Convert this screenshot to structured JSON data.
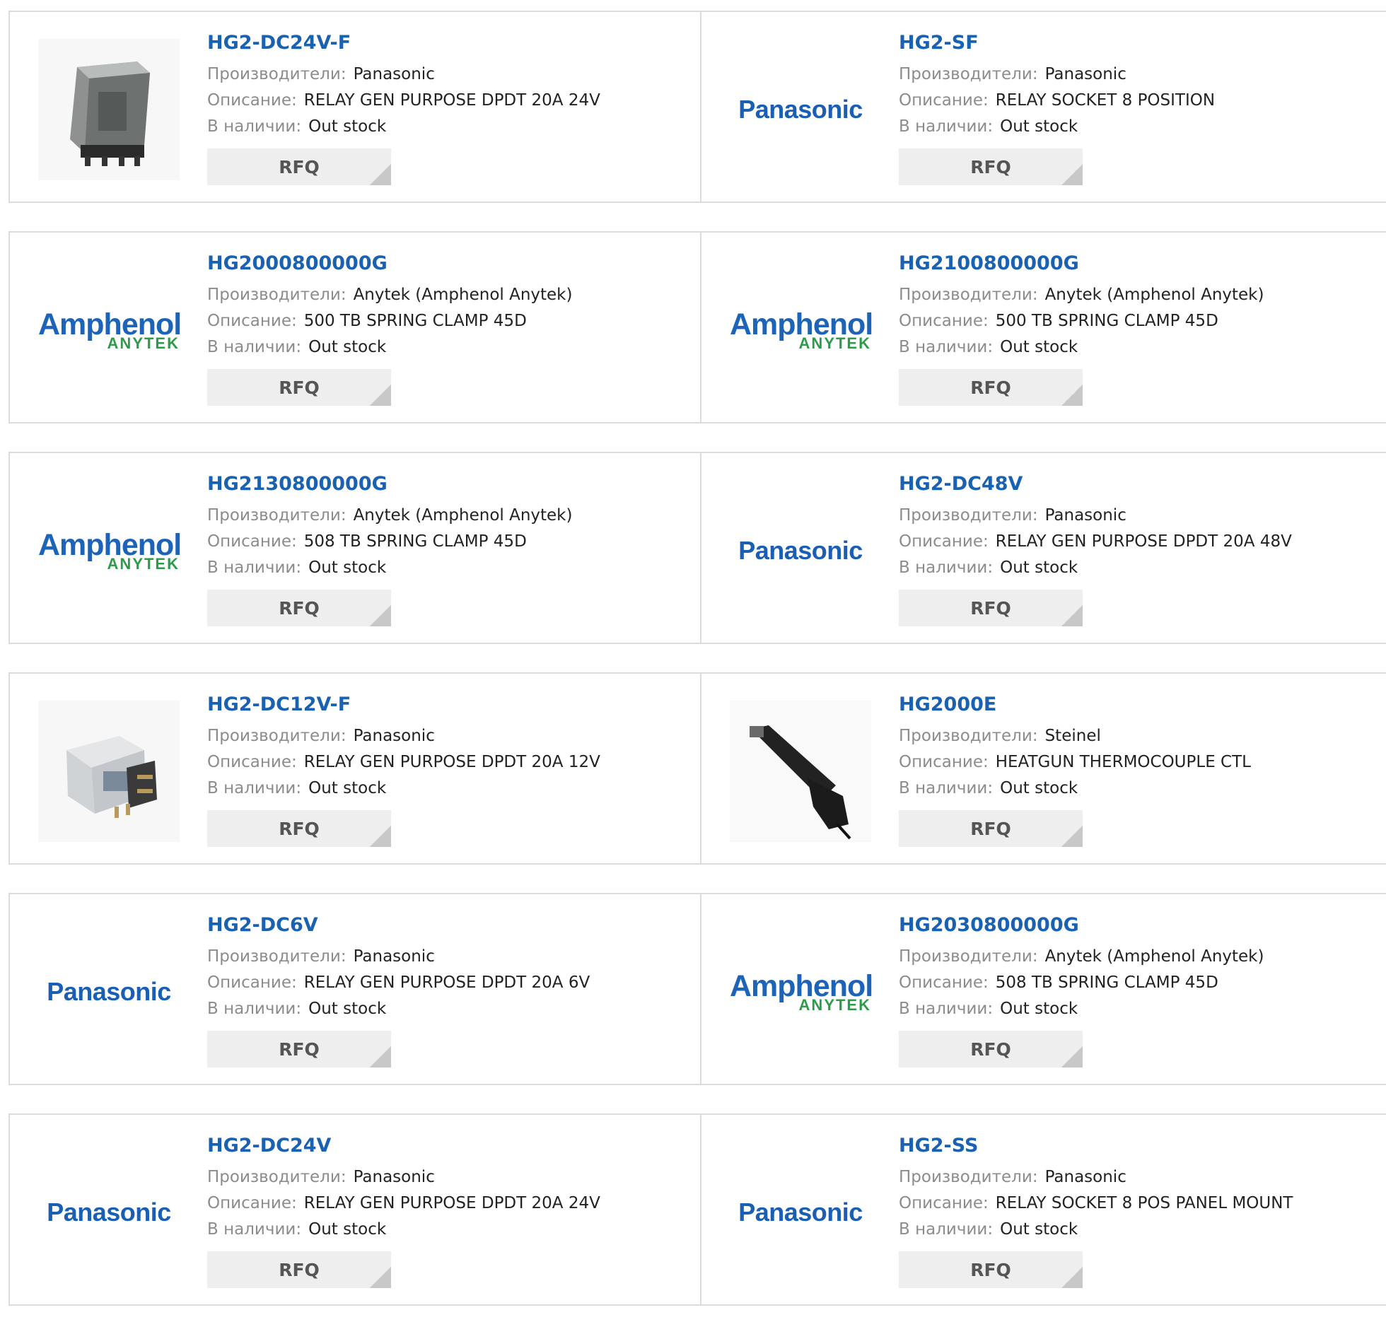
{
  "labels": {
    "manufacturer": "Производители:",
    "description": "Описание:",
    "stock": "В наличии:",
    "rfq": "RFQ"
  },
  "colors": {
    "link": "#1a62b0",
    "label": "#8c8c8c",
    "panasonic_logo": "#1a5fb4",
    "amphenol_logo": "#1d63b7",
    "anytek_logo": "#2d9c4a",
    "border": "#dcdcdc"
  },
  "logos": {
    "panasonic": "Panasonic",
    "amphenol": "Amphenol",
    "anytek": "ANYTEK"
  },
  "products": [
    {
      "part": "HG2-DC24V-F",
      "manufacturer": "Panasonic",
      "description": "RELAY GEN PURPOSE DPDT 20A 24V",
      "stock": "Out stock",
      "image": "relay-dark-photo"
    },
    {
      "part": "HG2-SF",
      "manufacturer": "Panasonic",
      "description": "RELAY SOCKET 8 POSITION",
      "stock": "Out stock",
      "image": "panasonic-logo"
    },
    {
      "part": "HG2000800000G",
      "manufacturer": "Anytek (Amphenol Anytek)",
      "description": "500 TB SPRING CLAMP 45D",
      "stock": "Out stock",
      "image": "amphenol-logo"
    },
    {
      "part": "HG2100800000G",
      "manufacturer": "Anytek (Amphenol Anytek)",
      "description": "500 TB SPRING CLAMP 45D",
      "stock": "Out stock",
      "image": "amphenol-logo"
    },
    {
      "part": "HG2130800000G",
      "manufacturer": "Anytek (Amphenol Anytek)",
      "description": "508 TB SPRING CLAMP 45D",
      "stock": "Out stock",
      "image": "amphenol-logo"
    },
    {
      "part": "HG2-DC48V",
      "manufacturer": "Panasonic",
      "description": "RELAY GEN PURPOSE DPDT 20A 48V",
      "stock": "Out stock",
      "image": "panasonic-logo"
    },
    {
      "part": "HG2-DC12V-F",
      "manufacturer": "Panasonic",
      "description": "RELAY GEN PURPOSE DPDT 20A 12V",
      "stock": "Out stock",
      "image": "relay-clear-photo"
    },
    {
      "part": "HG2000E",
      "manufacturer": "Steinel",
      "description": "HEATGUN THERMOCOUPLE CTL",
      "stock": "Out stock",
      "image": "heatgun-photo"
    },
    {
      "part": "HG2-DC6V",
      "manufacturer": "Panasonic",
      "description": "RELAY GEN PURPOSE DPDT 20A 6V",
      "stock": "Out stock",
      "image": "panasonic-logo"
    },
    {
      "part": "HG2030800000G",
      "manufacturer": "Anytek (Amphenol Anytek)",
      "description": "508 TB SPRING CLAMP 45D",
      "stock": "Out stock",
      "image": "amphenol-logo"
    },
    {
      "part": "HG2-DC24V",
      "manufacturer": "Panasonic",
      "description": "RELAY GEN PURPOSE DPDT 20A 24V",
      "stock": "Out stock",
      "image": "panasonic-logo"
    },
    {
      "part": "HG2-SS",
      "manufacturer": "Panasonic",
      "description": "RELAY SOCKET 8 POS PANEL MOUNT",
      "stock": "Out stock",
      "image": "panasonic-logo"
    }
  ]
}
